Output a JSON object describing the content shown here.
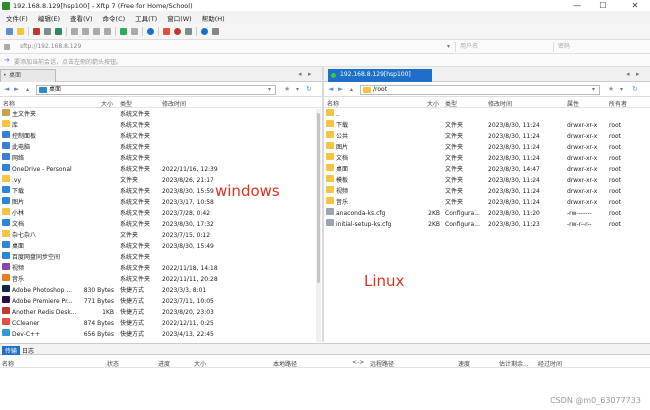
{
  "window": {
    "title": "192.168.8.129[hsp100] - Xftp 7 (Free for Home/School)",
    "minimize": "—",
    "maximize": "☐",
    "close": "✕"
  },
  "menu": [
    "文件(F)",
    "编辑(E)",
    "查看(V)",
    "命令(C)",
    "工具(T)",
    "窗口(W)",
    "帮助(H)"
  ],
  "address": {
    "value": "sftp://192.168.8.129",
    "user_placeholder": "用户名",
    "password_placeholder": "密码"
  },
  "hint": "要添加当前会话，点击左侧的箭头按钮。",
  "left_panel": {
    "tab": "桌面",
    "path": "桌面",
    "columns": {
      "name": "名称",
      "size": "大小",
      "type": "类型",
      "modified": "修改时间"
    },
    "rows": [
      {
        "name": "主文件夹",
        "size": "",
        "type": "系统文件夹",
        "modified": "",
        "icon": "#c8a24a"
      },
      {
        "name": "库",
        "size": "",
        "type": "系统文件夹",
        "modified": "",
        "icon": "#f5c443"
      },
      {
        "name": "控制面板",
        "size": "",
        "type": "系统文件夹",
        "modified": "",
        "icon": "#3b7dd8"
      },
      {
        "name": "此电脑",
        "size": "",
        "type": "系统文件夹",
        "modified": "",
        "icon": "#3b7dd8"
      },
      {
        "name": "网络",
        "size": "",
        "type": "系统文件夹",
        "modified": "",
        "icon": "#3b7dd8"
      },
      {
        "name": "OneDrive - Personal",
        "size": "",
        "type": "系统文件夹",
        "modified": "2022/11/16, 12:39",
        "icon": "#2b88d8"
      },
      {
        "name": ".vy",
        "size": "",
        "type": "文件夹",
        "modified": "2023/8/26, 21:17",
        "icon": "#f5c443"
      },
      {
        "name": "下载",
        "size": "",
        "type": "系统文件夹",
        "modified": "2023/8/30, 15:59",
        "icon": "#2b88d8"
      },
      {
        "name": "图片",
        "size": "",
        "type": "系统文件夹",
        "modified": "2023/3/17, 10:58",
        "icon": "#2b88d8"
      },
      {
        "name": "小林",
        "size": "",
        "type": "系统文件夹",
        "modified": "2023/7/28, 0:42",
        "icon": "#f5c443"
      },
      {
        "name": "文档",
        "size": "",
        "type": "系统文件夹",
        "modified": "2023/8/30, 17:32",
        "icon": "#2b88d8"
      },
      {
        "name": "杂七杂八",
        "size": "",
        "type": "文件夹",
        "modified": "2023/7/15, 0:12",
        "icon": "#f5c443"
      },
      {
        "name": "桌面",
        "size": "",
        "type": "系统文件夹",
        "modified": "2023/8/30, 15:49",
        "icon": "#2b88d8"
      },
      {
        "name": "百度网盘同步空间",
        "size": "",
        "type": "系统文件夹",
        "modified": "",
        "icon": "#2b88d8"
      },
      {
        "name": "视频",
        "size": "",
        "type": "系统文件夹",
        "modified": "2022/11/18, 14:18",
        "icon": "#8e44ad"
      },
      {
        "name": "音乐",
        "size": "",
        "type": "系统文件夹",
        "modified": "2022/11/11, 20:28",
        "icon": "#e67e22"
      },
      {
        "name": "Adobe Photoshop ...",
        "size": "830 Bytes",
        "type": "快捷方式",
        "modified": "2023/3/3, 8:01",
        "icon": "#0b2a4a"
      },
      {
        "name": "Adobe Premiere Pr...",
        "size": "771 Bytes",
        "type": "快捷方式",
        "modified": "2023/7/11, 10:05",
        "icon": "#2a0b4a"
      },
      {
        "name": "Another Redis Desk...",
        "size": "1KB",
        "type": "快捷方式",
        "modified": "2023/8/20, 23:03",
        "icon": "#c0392b"
      },
      {
        "name": "CCleaner",
        "size": "874 Bytes",
        "type": "快捷方式",
        "modified": "2022/12/11, 0:25",
        "icon": "#e74c3c"
      },
      {
        "name": "Dev-C++",
        "size": "656 Bytes",
        "type": "快捷方式",
        "modified": "2023/4/13, 22:45",
        "icon": "#3498db"
      }
    ]
  },
  "right_panel": {
    "tab": "192.168.8.129[hsp100]",
    "path": "/root",
    "columns": {
      "name": "名称",
      "size": "大小",
      "type": "类型",
      "modified": "修改时间",
      "attr": "属性",
      "owner": "所有者"
    },
    "rows": [
      {
        "name": "..",
        "size": "",
        "type": "",
        "modified": "",
        "attr": "",
        "owner": "",
        "icon": "#f5c443"
      },
      {
        "name": "下载",
        "size": "",
        "type": "文件夹",
        "modified": "2023/8/30, 11:24",
        "attr": "drwxr-xr-x",
        "owner": "root",
        "icon": "#f5c443"
      },
      {
        "name": "公共",
        "size": "",
        "type": "文件夹",
        "modified": "2023/8/30, 11:24",
        "attr": "drwxr-xr-x",
        "owner": "root",
        "icon": "#f5c443"
      },
      {
        "name": "图片",
        "size": "",
        "type": "文件夹",
        "modified": "2023/8/30, 11:24",
        "attr": "drwxr-xr-x",
        "owner": "root",
        "icon": "#f5c443"
      },
      {
        "name": "文档",
        "size": "",
        "type": "文件夹",
        "modified": "2023/8/30, 11:24",
        "attr": "drwxr-xr-x",
        "owner": "root",
        "icon": "#f5c443"
      },
      {
        "name": "桌面",
        "size": "",
        "type": "文件夹",
        "modified": "2023/8/30, 14:47",
        "attr": "drwxr-xr-x",
        "owner": "root",
        "icon": "#f5c443"
      },
      {
        "name": "模板",
        "size": "",
        "type": "文件夹",
        "modified": "2023/8/30, 11:24",
        "attr": "drwxr-xr-x",
        "owner": "root",
        "icon": "#f5c443"
      },
      {
        "name": "视频",
        "size": "",
        "type": "文件夹",
        "modified": "2023/8/30, 11:24",
        "attr": "drwxr-xr-x",
        "owner": "root",
        "icon": "#f5c443"
      },
      {
        "name": "音乐",
        "size": "",
        "type": "文件夹",
        "modified": "2023/8/30, 11:24",
        "attr": "drwxr-xr-x",
        "owner": "root",
        "icon": "#f5c443"
      },
      {
        "name": "anaconda-ks.cfg",
        "size": "2KB",
        "type": "Configura...",
        "modified": "2023/8/30, 11:20",
        "attr": "-rw-------",
        "owner": "root",
        "icon": "#9aa5b1"
      },
      {
        "name": "initial-setup-ks.cfg",
        "size": "2KB",
        "type": "Configura...",
        "modified": "2023/8/30, 11:23",
        "attr": "-rw-r--r--",
        "owner": "root",
        "icon": "#9aa5b1"
      }
    ]
  },
  "annotations": {
    "left": "windows",
    "right": "Linux"
  },
  "bottom_tabs": {
    "transfer": "传输",
    "log": "日志"
  },
  "transfer_columns": [
    "名称",
    "状态",
    "进度",
    "大小",
    "本地路径",
    "<->",
    "远程路径",
    "速度",
    "估计剩余...",
    "经过时间"
  ],
  "watermark": "CSDN @m0_63077733",
  "colors": {
    "accent": "#1e6fc8",
    "annotation": "#e0301e",
    "folder": "#f5c443"
  }
}
